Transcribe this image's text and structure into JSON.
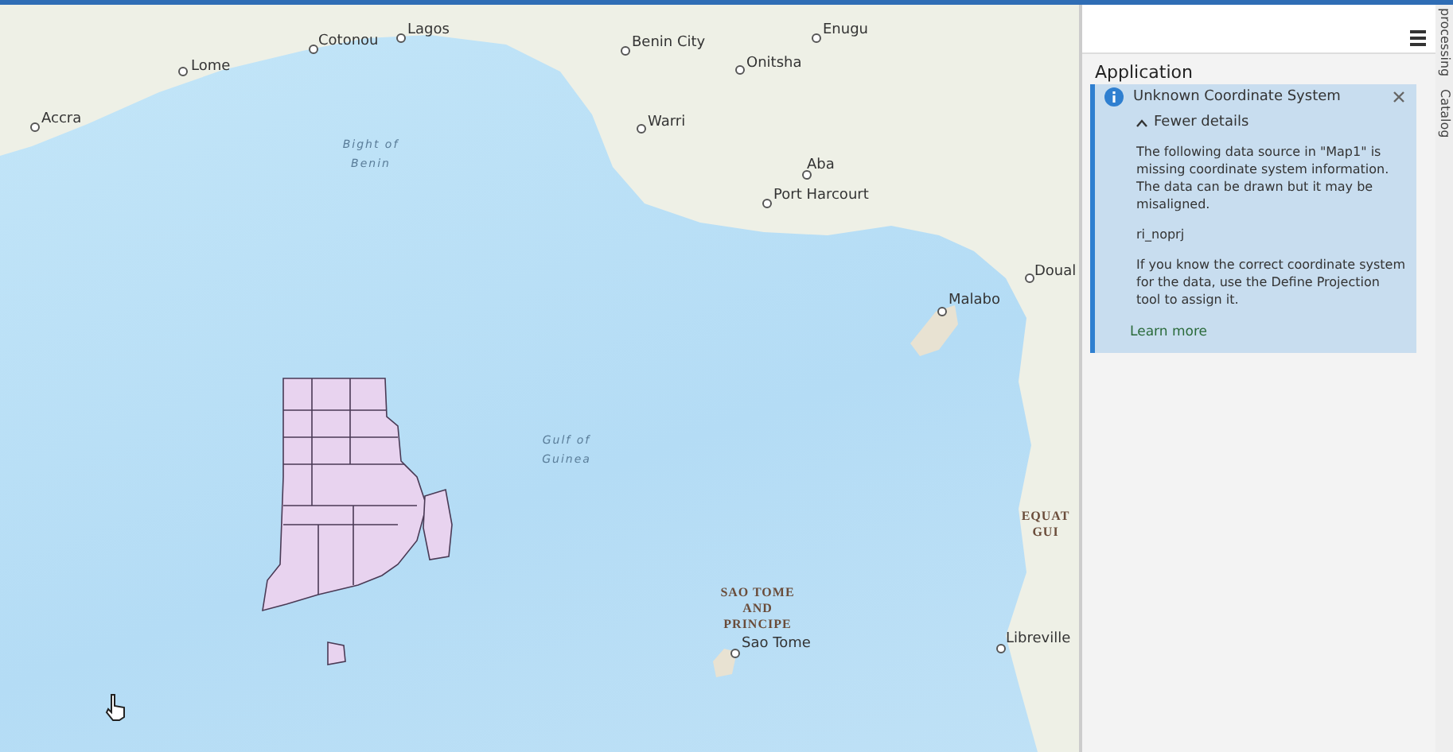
{
  "map": {
    "places": [
      {
        "kind": "city",
        "name": "Lagos"
      },
      {
        "kind": "city",
        "name": "Enugu"
      },
      {
        "kind": "city",
        "name": "Cotonou"
      },
      {
        "kind": "city",
        "name": "Benin City"
      },
      {
        "kind": "city",
        "name": "Lome"
      },
      {
        "kind": "city",
        "name": "Onitsha"
      },
      {
        "kind": "city",
        "name": "Accra"
      },
      {
        "kind": "city",
        "name": "Warri"
      },
      {
        "kind": "water",
        "name": "Bight of Benin"
      },
      {
        "kind": "city",
        "name": "Aba"
      },
      {
        "kind": "city",
        "name": "Port Harcourt"
      },
      {
        "kind": "city",
        "name": "Doual"
      },
      {
        "kind": "city",
        "name": "Malabo"
      },
      {
        "kind": "water",
        "name": "Gulf of Guinea"
      },
      {
        "kind": "country",
        "name": "EQUAT GUI"
      },
      {
        "kind": "country",
        "name": "SAO TOME AND PRINCIPE"
      },
      {
        "kind": "city",
        "name": "Sao Tome"
      },
      {
        "kind": "city",
        "name": "Libreville"
      }
    ]
  },
  "notifications": {
    "section": "Application",
    "items": [
      {
        "title": "Unknown Coordinate System",
        "toggle": "Fewer details",
        "expanded": true,
        "message": "The following data source in \"Map1\" is missing coordinate system information. The data can be drawn but it may be misaligned.",
        "source": "ri_noprj",
        "hint": "If you know the correct coordinate system for the data, use the Define Projection tool to assign it.",
        "link": "Learn more"
      }
    ]
  },
  "side_tabs": [
    {
      "label": "processing"
    },
    {
      "label": "Catalog"
    }
  ]
}
